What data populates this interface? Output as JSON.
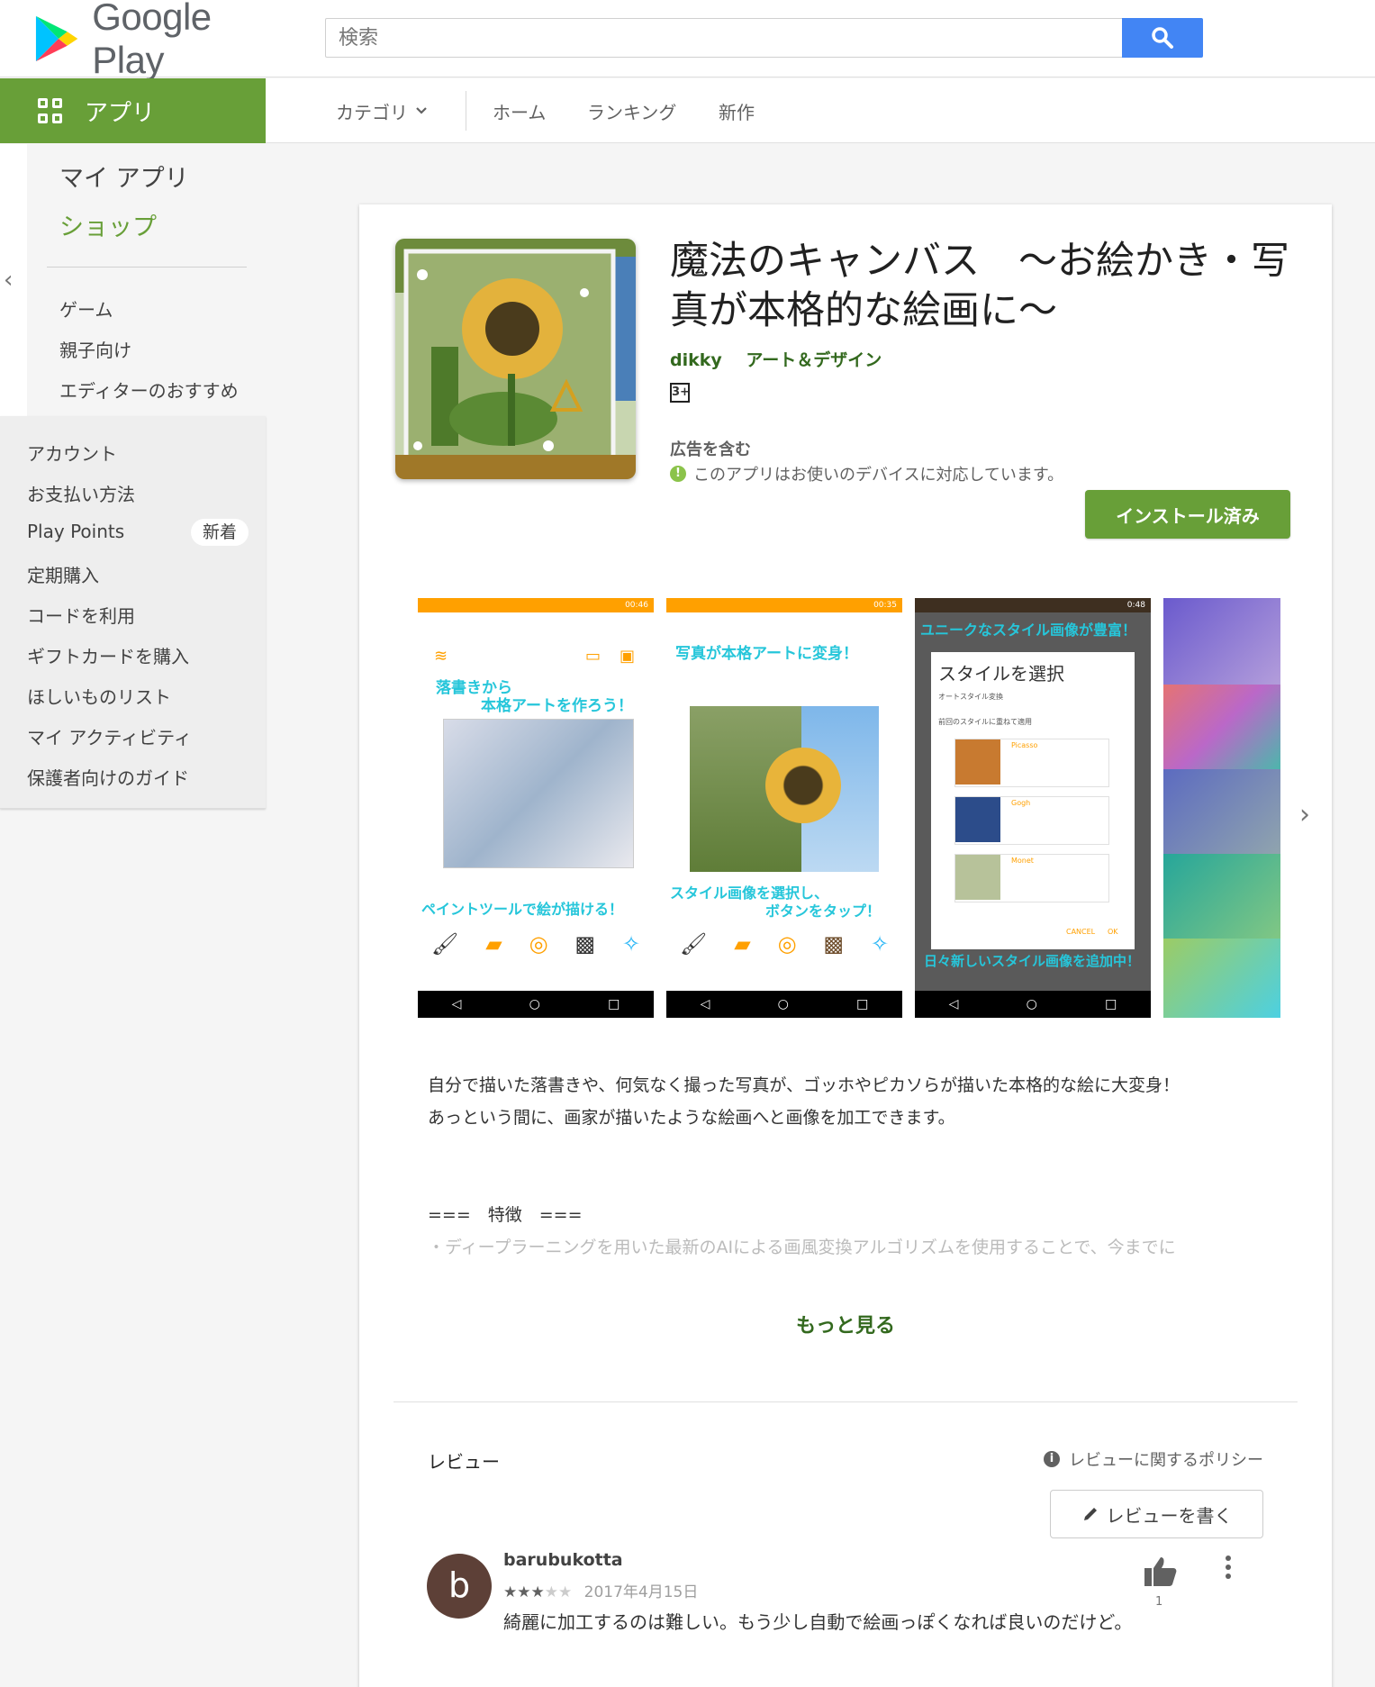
{
  "header": {
    "logo_text": "Google Play",
    "search_placeholder": "検索"
  },
  "subnav": {
    "apps_label": "アプリ",
    "category_label": "カテゴリ",
    "home_label": "ホーム",
    "ranking_label": "ランキング",
    "new_label": "新作"
  },
  "sidebar": {
    "my_apps": "マイ アプリ",
    "shop": "ショップ",
    "games": "ゲーム",
    "family": "親子向け",
    "editors_choice": "エディターのおすすめ",
    "account": "アカウント",
    "payment": "お支払い方法",
    "play_points": "Play Points",
    "play_points_badge": "新着",
    "subscriptions": "定期購入",
    "redeem": "コードを利用",
    "gift_card": "ギフトカードを購入",
    "wishlist": "ほしいものリスト",
    "my_activity": "マイ アクティビティ",
    "parent_guide": "保護者向けのガイド"
  },
  "app": {
    "title": "魔法のキャンバス　～お絵かき・写真が本格的な絵画に～",
    "developer": "dikky",
    "category": "アート＆デザイン",
    "content_rating": "3+",
    "contains_ads": "広告を含む",
    "compat_text": "このアプリはお使いのデバイスに対応しています。",
    "install_label": "インストール済み"
  },
  "screenshots": [
    {
      "status_time": "00:46",
      "cap1": "落書きから",
      "cap2": "本格アートを作ろう！",
      "cap3": "ペイントツールで絵が描ける！"
    },
    {
      "status_time": "00:35",
      "cap1": "写真が本格アートに変身！",
      "cap2": "スタイル画像を選択し、",
      "cap3": "ボタンをタップ！"
    },
    {
      "status_time": "0:48",
      "cap1": "ユニークなスタイル画像が豊富！",
      "dialog_title": "スタイルを選択",
      "opt1": "オートスタイル変換",
      "opt2": "前回のスタイルに重ねて適用",
      "style1": "Picasso",
      "style2": "Gogh",
      "style3": "Monet",
      "cancel": "CANCEL",
      "ok": "OK",
      "cap2": "日々新しいスタイル画像を追加中！"
    }
  ],
  "description": {
    "line1": "自分で描いた落書きや、何気なく撮った写真が、ゴッホやピカソらが描いた本格的な絵に大変身！",
    "line2": "あっという間に、画家が描いたような絵画へと画像を加工できます。",
    "features_header": "===　特徴　===",
    "features_line1": "・ディープラーニングを用いた最新のAIによる画風変換アルゴリズムを使用することで、今までに",
    "more_label": "もっと見る"
  },
  "reviews": {
    "title": "レビュー",
    "policy_label": "レビューに関するポリシー",
    "write_label": "レビューを書く",
    "items": [
      {
        "avatar_letter": "b",
        "author": "barubukotta",
        "rating": 3,
        "date": "2017年4月15日",
        "body": "綺麗に加工するのは難しい。もう少し自動で絵画っぽくなれば良いのだけど。",
        "helpful_count": "1"
      }
    ]
  },
  "colors": {
    "brand_green": "#689f38",
    "dark_green": "#33691e",
    "search_blue": "#4285f4",
    "status_orange": "#ffa000"
  }
}
